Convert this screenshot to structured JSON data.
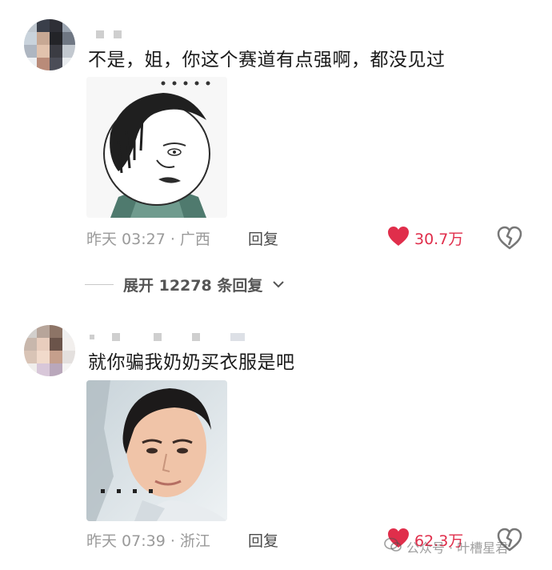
{
  "comments": [
    {
      "text": "不是，姐，你这个赛道有点强啊，都没见过",
      "timestamp": "昨天 03:27 · 广西",
      "reply_label": "回复",
      "likes": "30.7万",
      "media": "meme sticker"
    },
    {
      "text": "就你骗我奶奶买衣服是吧",
      "timestamp": "昨天 07:39 · 浙江",
      "reply_label": "回复",
      "likes": "62.3万",
      "media": "portrait photo"
    }
  ],
  "expand_replies": {
    "label": "展开 12278 条回复"
  },
  "watermark": {
    "text": "公众号 · 叶槽星君"
  },
  "colors": {
    "like": "#e02e4b",
    "meta": "#9a9a9a",
    "text": "#1a1a1a"
  },
  "icons": [
    "heart-icon",
    "broken-heart-icon",
    "chevron-down-icon"
  ]
}
